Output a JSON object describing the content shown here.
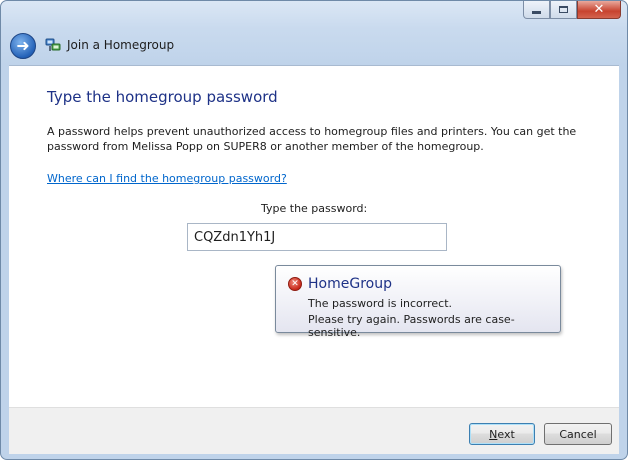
{
  "window": {
    "title": "Join a Homegroup",
    "caption_buttons": {
      "minimize": "minimize",
      "maximize": "maximize",
      "close": "✕"
    }
  },
  "main": {
    "heading": "Type the homegroup password",
    "description": "A password helps prevent unauthorized access to homegroup files and printers. You can get the password from Melissa Popp on SUPER8 or another member of the homegroup.",
    "help_link": "Where can I find the homegroup password?",
    "password_label": "Type the password:",
    "password_value": "CQZdn1Yh1J"
  },
  "error_balloon": {
    "icon": "error-icon",
    "title": "HomeGroup",
    "line1": "The password is incorrect.",
    "line2": "Please try again. Passwords are case-sensitive."
  },
  "footer": {
    "next_mnemonic": "N",
    "next_rest": "ext",
    "cancel_label": "Cancel"
  },
  "icons": {
    "back": "back-arrow-icon",
    "wizard": "homegroup-icon"
  },
  "colors": {
    "heading": "#1e3287",
    "link": "#0066cc",
    "frame": "#c9daee",
    "error": "#c8281a"
  }
}
